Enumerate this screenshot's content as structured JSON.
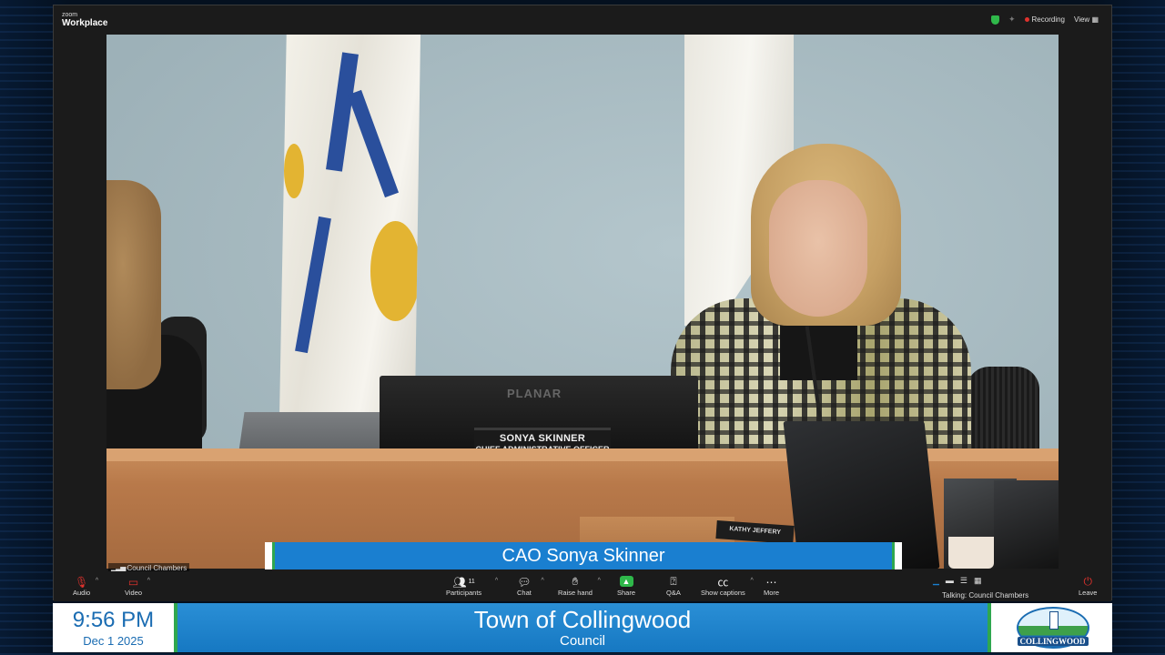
{
  "zoom": {
    "brand_small": "zoom",
    "brand_big": "Workplace",
    "recording_label": "Recording",
    "view_label": "View"
  },
  "video": {
    "participant_label": "Council Chambers",
    "caption": "CAO Sonya Skinner",
    "nameplate": {
      "name": "SONYA SKINNER",
      "title": "CHIEF ADMINISTRATIVE OFFICER"
    },
    "monitor_brand": "PLANAR",
    "nameplate_second": "KATHY JEFFERY"
  },
  "toolbar": {
    "audio": "Audio",
    "video": "Video",
    "participants": "Participants",
    "participants_count": "11",
    "chat": "Chat",
    "raise_hand": "Raise hand",
    "share": "Share",
    "qa": "Q&A",
    "show_captions": "Show captions",
    "more": "More",
    "talking": "Talking: Council Chambers",
    "leave": "Leave"
  },
  "broadcast": {
    "time": "9:56 PM",
    "date": "Dec 1 2025",
    "town": "Town of Collingwood",
    "meeting": "Council",
    "logo_text": "COLLINGWOOD"
  },
  "colors": {
    "accent_blue": "#1a7fd0",
    "accent_green": "#2fa74f",
    "record_red": "#e0322d"
  }
}
